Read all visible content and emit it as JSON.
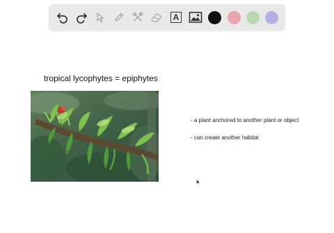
{
  "toolbar": {
    "tools": [
      {
        "icon": "undo-icon"
      },
      {
        "icon": "redo-icon"
      },
      {
        "icon": "pointer-icon"
      },
      {
        "icon": "pencil-icon"
      },
      {
        "icon": "tools-icon"
      },
      {
        "icon": "eraser-icon"
      },
      {
        "icon": "text-icon",
        "glyph": "A"
      },
      {
        "icon": "image-icon"
      }
    ],
    "colors": [
      "#111111",
      "#e8a3ab",
      "#b9d7b0",
      "#b7b0e8"
    ]
  },
  "canvas": {
    "title": "tropical lycophytes = epiphytes",
    "notes": [
      "- a plant anchored to another plant or object",
      "- can create another habitat"
    ]
  }
}
